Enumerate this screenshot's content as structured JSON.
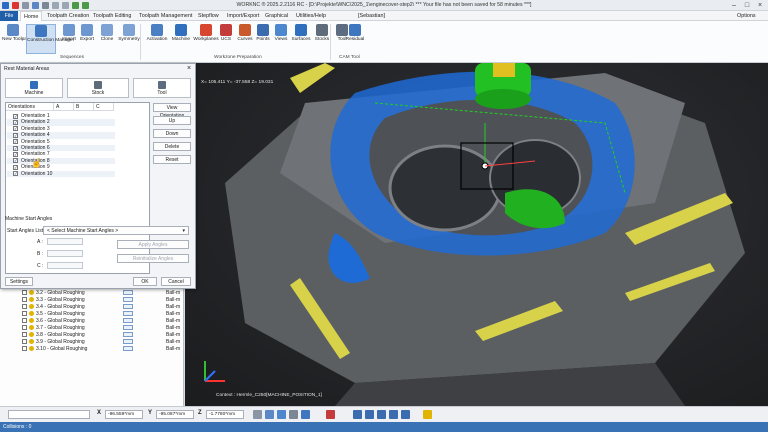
{
  "title_bar": {
    "title": "WORKNC ® 2025.2.2116 RC - [D:\\Projekte\\WNC\\2025_1\\enginecover-step2\\ *** Your file has not been saved for 58 minutes ***]",
    "user": "[Sebastian]",
    "options": "Options"
  },
  "menu": {
    "file": "File",
    "items": [
      "Home",
      "Toolpath Creation",
      "Toolpath Editing",
      "Toolpath Management",
      "Stepflow",
      "Import/Export",
      "Graphical",
      "Utilities/Help"
    ]
  },
  "ribbon": {
    "buttons": [
      {
        "label": "New Toolpath",
        "icon": "new-toolpath-icon"
      },
      {
        "label": "Construction Manager",
        "icon": "construction-manager-icon"
      },
      {
        "label": "Import",
        "icon": "import-icon"
      },
      {
        "label": "Export",
        "icon": "export-icon"
      },
      {
        "label": "Clone",
        "icon": "clone-icon"
      },
      {
        "label": "Symmetry",
        "icon": "symmetry-icon"
      },
      {
        "label": "Activation",
        "icon": "activation-icon"
      },
      {
        "label": "Machine",
        "icon": "machine-icon"
      },
      {
        "label": "Workplanes",
        "icon": "workplanes-icon"
      },
      {
        "label": "UCS",
        "icon": "ucs-icon"
      },
      {
        "label": "Curves",
        "icon": "curves-icon"
      },
      {
        "label": "Points",
        "icon": "points-icon"
      },
      {
        "label": "Views",
        "icon": "views-icon"
      },
      {
        "label": "Surfaces",
        "icon": "surfaces-icon"
      },
      {
        "label": "Stocks",
        "icon": "stocks-icon"
      },
      {
        "label": "Tool",
        "icon": "tool-icon"
      },
      {
        "label": "Residual",
        "icon": "residual-icon"
      }
    ],
    "groups": [
      "Sequences",
      "Workzone Preparation",
      "CAM Tool"
    ]
  },
  "dialog": {
    "title": "Rest Material Areas",
    "tabs": [
      "Machine",
      "Stock",
      "Tool"
    ],
    "columns": [
      "Orientations",
      "A",
      "B",
      "C"
    ],
    "orientations": [
      "Orientation 1",
      "Orientation 2",
      "Orientation 3",
      "Orientation 4",
      "Orientation 5",
      "Orientation 6",
      "Orientation 7",
      "Orientation 8",
      "Orientation 9",
      "Orientation 10"
    ],
    "buttons": {
      "view": "View Orientation",
      "up": "Up",
      "down": "Down",
      "delete": "Delete",
      "reset": "Reset"
    },
    "msa_title": "Machine Start Angles",
    "start_angles_list_label": "Start Angles List",
    "start_angles_placeholder": "< Select Machine Start Angles >",
    "axis_a": "A :",
    "axis_b": "B :",
    "axis_c": "C :",
    "apply_angles": "Apply Angles",
    "reinitialize": "Reinitialize Angles",
    "settings": "Settings",
    "ok": "OK",
    "cancel": "Cancel"
  },
  "toolpaths": [
    {
      "name": "3.2 - Global Roughing",
      "tool": "Ball-m"
    },
    {
      "name": "3.3 - Global Roughing",
      "tool": "Ball-m"
    },
    {
      "name": "3.4 - Global Roughing",
      "tool": "Ball-m"
    },
    {
      "name": "3.5 - Global Roughing",
      "tool": "Ball-m"
    },
    {
      "name": "3.6 - Global Roughing",
      "tool": "Ball-m"
    },
    {
      "name": "3.7 - Global Roughing",
      "tool": "Ball-m"
    },
    {
      "name": "3.8 - Global Roughing",
      "tool": "Ball-m"
    },
    {
      "name": "3.9 - Global Roughing",
      "tool": "Ball-m"
    },
    {
      "name": "3.10 - Global Roughing",
      "tool": "Ball-m"
    }
  ],
  "viewport": {
    "coordinates": "X= 105.411   Y= -37.558   Z= 19.031",
    "context": "Context : Hermle_C250[MACHINE_POSITION_1]"
  },
  "statusbar": {
    "x_label": "X",
    "x_value": "-96.559*mm",
    "y_label": "Y",
    "y_value": "-95.087*mm",
    "z_label": "Z",
    "z_value": "-1.7780*mm",
    "collisions": "Collisions : 0"
  },
  "colors": {
    "accent": "#1f5fa8",
    "stock_blue": "#1f6bd6",
    "green": "#20b020",
    "yellow": "#d8d24a"
  }
}
